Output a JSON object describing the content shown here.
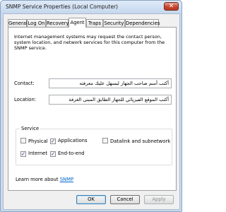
{
  "window": {
    "title": "SNMP Service Properties (Local Computer)",
    "close_glyph": "✕"
  },
  "tabs": [
    {
      "label": "General"
    },
    {
      "label": "Log On"
    },
    {
      "label": "Recovery"
    },
    {
      "label": "Agent",
      "active": true
    },
    {
      "label": "Traps"
    },
    {
      "label": "Security"
    },
    {
      "label": "Dependencies"
    }
  ],
  "agent": {
    "description": "Internet management systems may request the contact person, system location, and network services for this computer from the SNMP service.",
    "contact_label": "Contact:",
    "contact_value": "أكتب أسم صاحب الجهاز ليسهل عليك معرفته",
    "location_label": "Location:",
    "location_value": "أكتب الموقع الفيزيائي للجهاز الطابق المبنى الغرفة"
  },
  "service": {
    "title": "Service",
    "options": [
      {
        "label": "Physical",
        "checked": false
      },
      {
        "label": "Applications",
        "checked": true
      },
      {
        "label": "Datalink and subnetwork",
        "checked": false
      },
      {
        "label": "Internet",
        "checked": true
      },
      {
        "label": "End-to-end",
        "checked": true
      }
    ],
    "check_glyph": "✓"
  },
  "learn_more": {
    "text": "Learn more about",
    "link": "SNMP"
  },
  "buttons": {
    "ok": "OK",
    "cancel": "Cancel",
    "apply": "Apply"
  }
}
